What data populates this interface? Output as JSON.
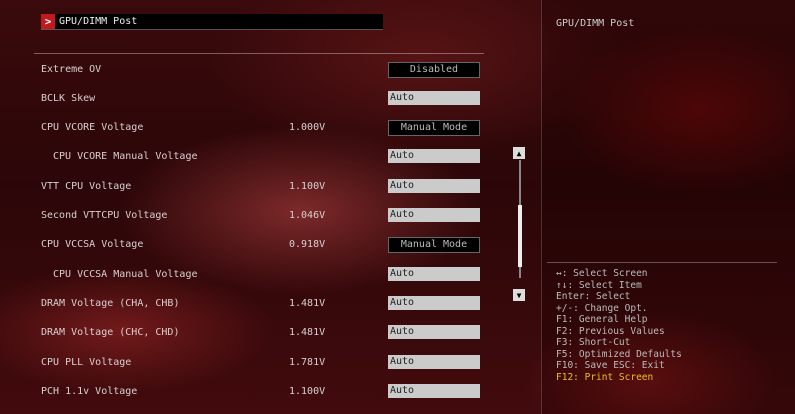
{
  "header": {
    "title": "GPU/DIMM Post",
    "arrow": ">"
  },
  "rows": [
    {
      "label": "Extreme OV",
      "current": "",
      "value": "Disabled",
      "style": "dark",
      "sub": false
    },
    {
      "label": "BCLK Skew",
      "current": "",
      "value": "Auto",
      "style": "light",
      "sub": false
    },
    {
      "label": "CPU VCORE Voltage",
      "current": "1.000V",
      "value": "Manual Mode",
      "style": "dark",
      "sub": false
    },
    {
      "label": "CPU VCORE Manual Voltage",
      "current": "",
      "value": "Auto",
      "style": "light",
      "sub": true
    },
    {
      "label": "VTT CPU Voltage",
      "current": "1.100V",
      "value": "Auto",
      "style": "light",
      "sub": false
    },
    {
      "label": "Second VTTCPU Voltage",
      "current": "1.046V",
      "value": "Auto",
      "style": "light",
      "sub": false
    },
    {
      "label": "CPU VCCSA Voltage",
      "current": "0.918V",
      "value": "Manual Mode",
      "style": "dark",
      "sub": false
    },
    {
      "label": "CPU VCCSA Manual Voltage",
      "current": "",
      "value": "Auto",
      "style": "light",
      "sub": true
    },
    {
      "label": "DRAM Voltage (CHA, CHB)",
      "current": "1.481V",
      "value": "Auto",
      "style": "light",
      "sub": false
    },
    {
      "label": "DRAM Voltage (CHC, CHD)",
      "current": "1.481V",
      "value": "Auto",
      "style": "light",
      "sub": false
    },
    {
      "label": "CPU PLL Voltage",
      "current": "1.781V",
      "value": "Auto",
      "style": "light",
      "sub": false
    },
    {
      "label": "PCH 1.1v Voltage",
      "current": "1.100V",
      "value": "Auto",
      "style": "light",
      "sub": false
    }
  ],
  "scrollbar": {
    "up": "▲",
    "down": "▼"
  },
  "help": {
    "title": "GPU/DIMM Post",
    "keys": [
      "↔: Select Screen",
      "↑↓: Select Item",
      "Enter: Select",
      "+/-: Change Opt.",
      "F1: General Help",
      "F2: Previous Values",
      "F3: Short-Cut",
      "F5: Optimized Defaults",
      "F10: Save  ESC: Exit",
      "F12: Print Screen"
    ],
    "highlight_color": "#e8c020"
  }
}
